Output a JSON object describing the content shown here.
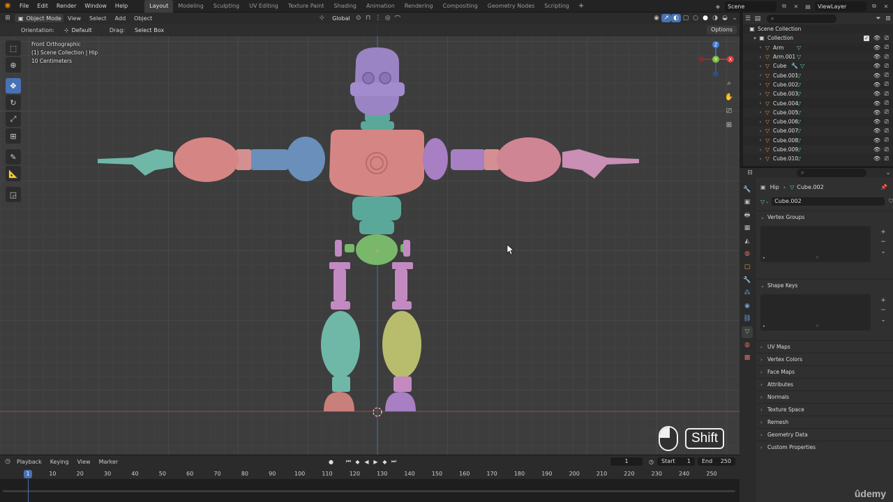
{
  "app": {
    "menu": [
      "File",
      "Edit",
      "Render",
      "Window",
      "Help"
    ],
    "workspaces": [
      "Layout",
      "Modeling",
      "Sculpting",
      "UV Editing",
      "Texture Paint",
      "Shading",
      "Animation",
      "Rendering",
      "Compositing",
      "Geometry Nodes",
      "Scripting"
    ],
    "active_workspace": "Layout",
    "add_workspace": "+",
    "scene": "Scene",
    "view_layer": "ViewLayer"
  },
  "viewport": {
    "mode": "Object Mode",
    "menus": [
      "View",
      "Select",
      "Add",
      "Object"
    ],
    "transform_orientation": "Global",
    "orientation_label": "Orientation:",
    "orientation_value": "Default",
    "drag_label": "Drag:",
    "drag_value": "Select Box",
    "options": "Options",
    "info": [
      "Front Orthographic",
      "(1) Scene Collection | Hip",
      "10 Centimeters"
    ],
    "gizmo_axes": {
      "z": "Z",
      "y": "Y",
      "x": "X"
    },
    "key_overlay": "Shift"
  },
  "timeline": {
    "menus": [
      "Playback",
      "Keying",
      "View",
      "Marker"
    ],
    "current_frame": "1",
    "start_label": "Start",
    "start": "1",
    "end_label": "End",
    "end": "250",
    "ticks": [
      "1",
      "10",
      "20",
      "30",
      "40",
      "50",
      "60",
      "70",
      "80",
      "90",
      "100",
      "110",
      "120",
      "130",
      "140",
      "150",
      "160",
      "170",
      "180",
      "190",
      "200",
      "210",
      "220",
      "230",
      "240",
      "250"
    ]
  },
  "outliner": {
    "scene_collection": "Scene Collection",
    "collection": "Collection",
    "objects": [
      "Arm",
      "Arm.001",
      "Cube",
      "Cube.001",
      "Cube.002",
      "Cube.003",
      "Cube.004",
      "Cube.005",
      "Cube.006",
      "Cube.007",
      "Cube.008",
      "Cube.009",
      "Cube.010"
    ]
  },
  "properties": {
    "object": "Hip",
    "mesh": "Cube.002",
    "panels": {
      "vertex_groups": "Vertex Groups",
      "shape_keys": "Shape Keys",
      "collapsed": [
        "UV Maps",
        "Vertex Colors",
        "Face Maps",
        "Attributes",
        "Normals",
        "Texture Space",
        "Remesh",
        "Geometry Data",
        "Custom Properties"
      ]
    }
  },
  "watermark": "ûdemy",
  "colors": {
    "accent": "#4772b3",
    "viewport_bg": "#3d3d3d",
    "panel_bg": "#2b2b2b",
    "object_icon": "#e88c35",
    "mesh_icon": "#5fd4a0"
  }
}
